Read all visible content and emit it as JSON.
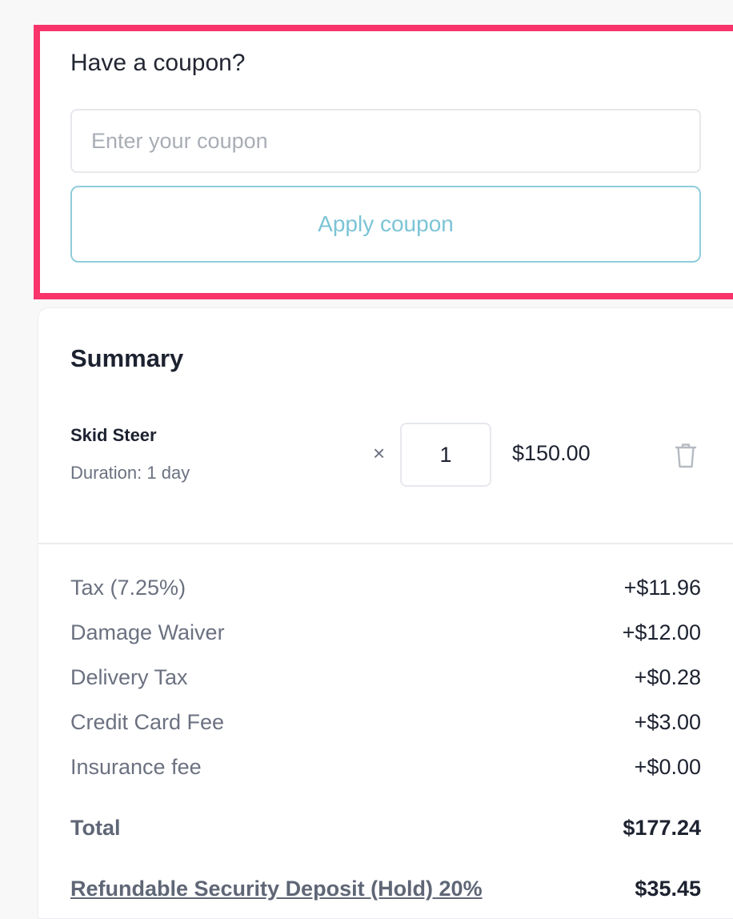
{
  "coupon": {
    "title": "Have a coupon?",
    "input_placeholder": "Enter your coupon",
    "input_value": "",
    "apply_label": "Apply coupon"
  },
  "summary": {
    "title": "Summary",
    "item": {
      "name": "Skid Steer",
      "duration": "Duration: 1 day",
      "times_symbol": "×",
      "quantity": "1",
      "price": "$150.00",
      "delete_icon": "trash-icon"
    },
    "fees": [
      {
        "label": "Tax (7.25%)",
        "value": "+$11.96"
      },
      {
        "label": "Damage Waiver",
        "value": "+$12.00"
      },
      {
        "label": "Delivery Tax",
        "value": "+$0.28"
      },
      {
        "label": "Credit Card Fee",
        "value": "+$3.00"
      },
      {
        "label": "Insurance fee",
        "value": "+$0.00"
      }
    ],
    "total_label": "Total",
    "total_value": "$177.24",
    "deposit_label": "Refundable Security Deposit (Hold) 20%",
    "deposit_value": "$35.45"
  },
  "colors": {
    "highlight": "#f8346b",
    "accent": "#7cc4d6"
  }
}
